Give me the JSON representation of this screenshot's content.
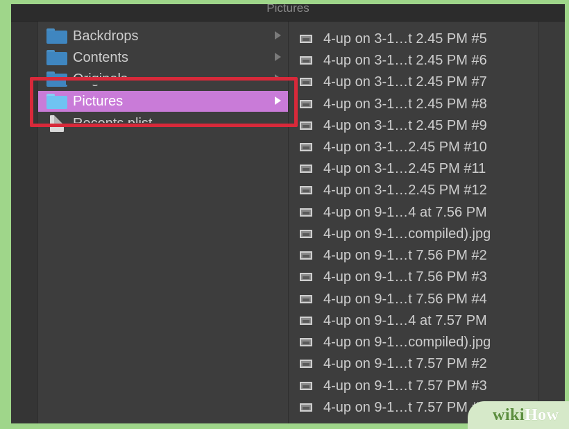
{
  "window": {
    "title": "Pictures"
  },
  "column1": {
    "items": [
      {
        "label": "Backdrops",
        "type": "folder",
        "has_children": true,
        "selected": false
      },
      {
        "label": "Contents",
        "type": "folder",
        "has_children": true,
        "selected": false
      },
      {
        "label": "Originals",
        "type": "folder",
        "has_children": true,
        "selected": false,
        "partially_hidden": true
      },
      {
        "label": "Pictures",
        "type": "folder",
        "has_children": true,
        "selected": true
      },
      {
        "label": "Recents.plist",
        "type": "file",
        "has_children": false,
        "selected": false,
        "partially_hidden": true
      }
    ]
  },
  "column2": {
    "items": [
      {
        "label": "4-up on 3-1…t 2.45 PM #5"
      },
      {
        "label": "4-up on 3-1…t 2.45 PM #6"
      },
      {
        "label": "4-up on 3-1…t 2.45 PM #7"
      },
      {
        "label": "4-up on 3-1…t 2.45 PM #8"
      },
      {
        "label": "4-up on 3-1…t 2.45 PM #9"
      },
      {
        "label": "4-up on 3-1…2.45 PM #10"
      },
      {
        "label": "4-up on 3-1…2.45 PM #11"
      },
      {
        "label": "4-up on 3-1…2.45 PM #12"
      },
      {
        "label": "4-up on 9-1…4 at 7.56 PM"
      },
      {
        "label": "4-up on 9-1…compiled).jpg"
      },
      {
        "label": "4-up on 9-1…t 7.56 PM #2"
      },
      {
        "label": "4-up on 9-1…t 7.56 PM #3"
      },
      {
        "label": "4-up on 9-1…t 7.56 PM #4"
      },
      {
        "label": "4-up on 9-1…4 at 7.57 PM"
      },
      {
        "label": "4-up on 9-1…compiled).jpg"
      },
      {
        "label": "4-up on 9-1…t 7.57 PM #2"
      },
      {
        "label": "4-up on 9-1…t 7.57 PM #3"
      },
      {
        "label": "4-up on 9-1…t 7.57 PM #4"
      }
    ]
  },
  "watermark": {
    "wiki": "wiki",
    "how": "How"
  },
  "colors": {
    "background_frame": "#9fd68a",
    "window_bg": "#3d3d3d",
    "selection": "#c97bd8",
    "highlight_box": "#d8293a",
    "folder": "#3f86c0"
  },
  "icons": {
    "folder": "folder-icon",
    "file": "file-icon",
    "image": "image-file-icon",
    "disclosure": "chevron-right-icon"
  }
}
